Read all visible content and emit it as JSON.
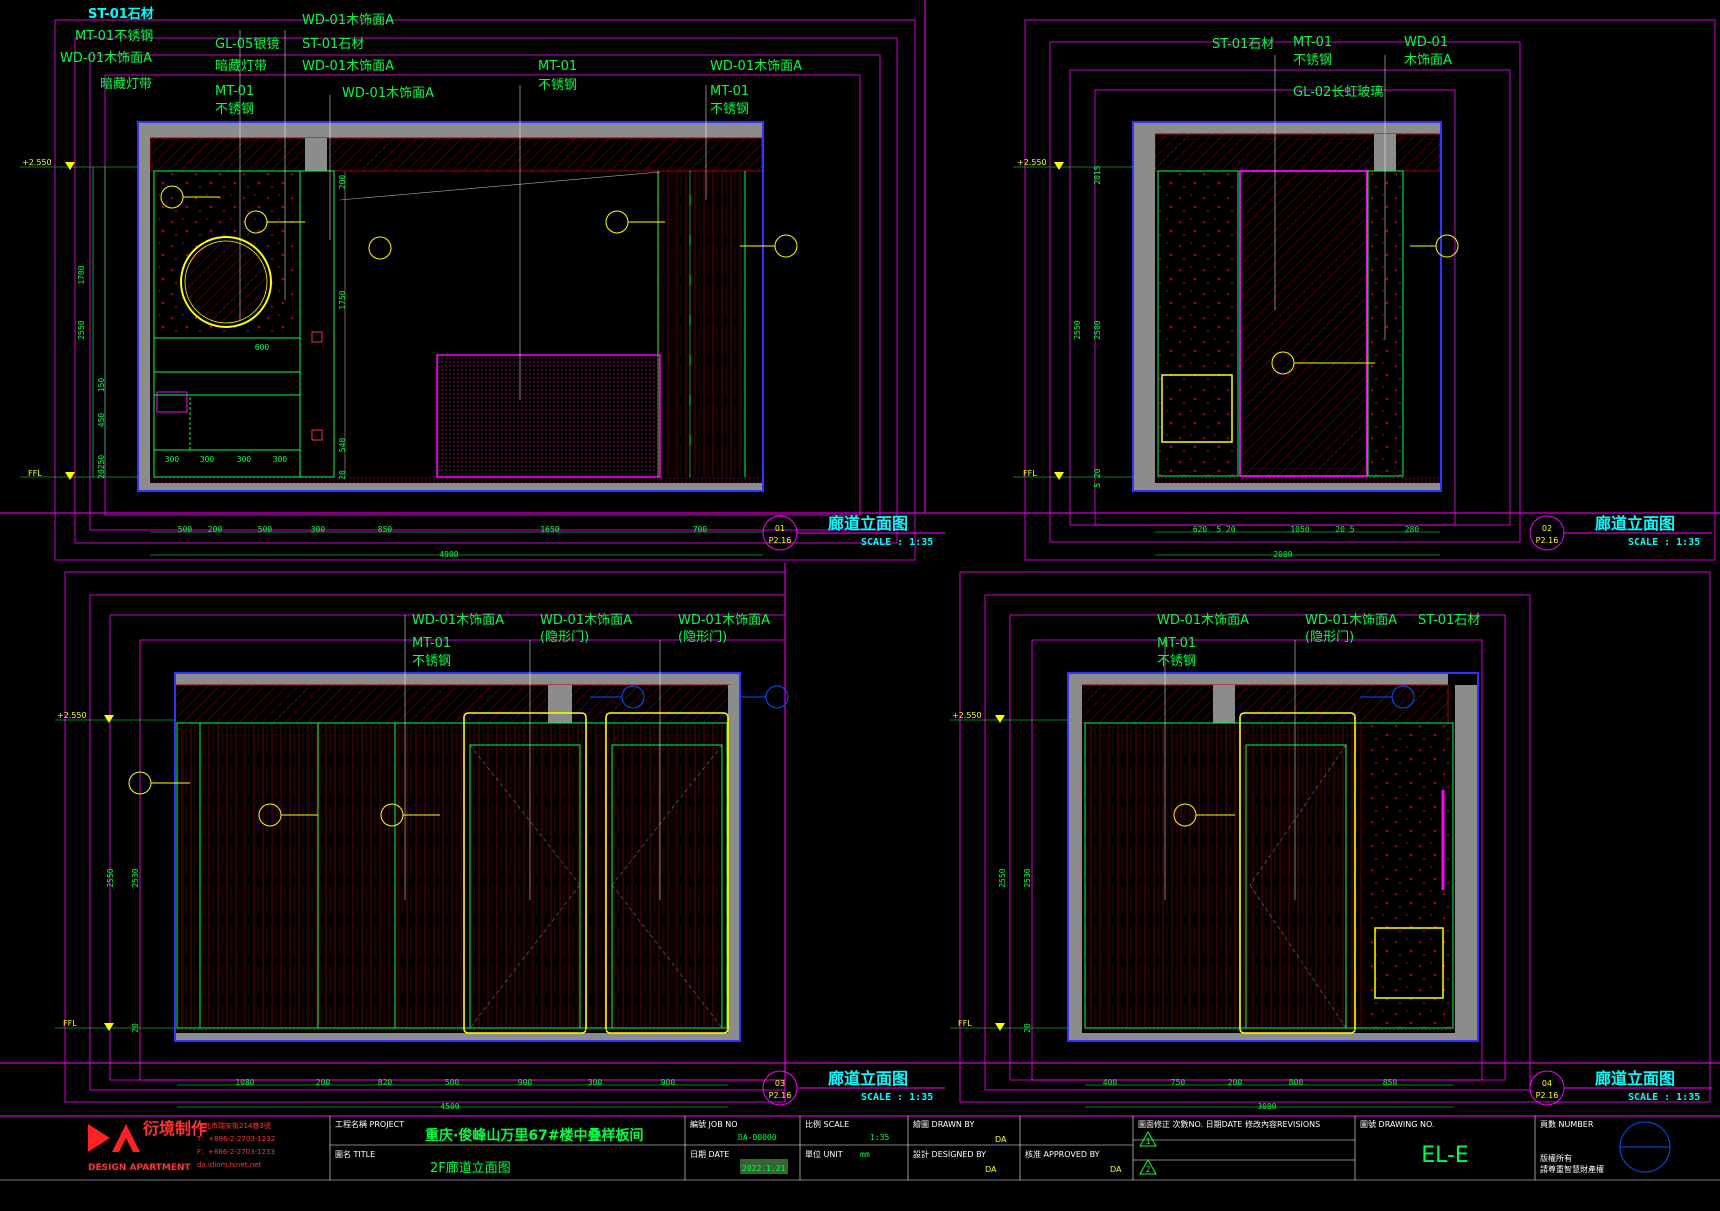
{
  "panels": [
    {
      "number": "01",
      "sheet": "P2.16",
      "title": "廊道立面图",
      "scale": "SCALE : 1:35",
      "labels": [
        "ST-01石材",
        "MT-01不锈钢",
        "WD-01木饰面A",
        "暗藏灯带",
        "GL-05银镜",
        "暗藏灯带",
        "MT-01",
        "不锈钢",
        "WD-01木饰面A",
        "ST-01石材",
        "WD-01木饰面A",
        "WD-01木饰面A",
        "MT-01",
        "不锈钢",
        "WD-01木饰面A",
        "MT-01",
        "不锈钢"
      ],
      "level_top": "+2.550",
      "level_bottom": "FFL",
      "dims_bottom": [
        "500",
        "200",
        "500",
        "300",
        "850",
        "1650",
        "700"
      ],
      "dim_total": "4900",
      "dims_left": [
        "1700",
        "2550",
        "150",
        "450",
        "250",
        "20"
      ],
      "dims_mid": [
        "600",
        "300",
        "300",
        "300",
        "300",
        "200",
        "1750",
        "540",
        "20"
      ]
    },
    {
      "number": "02",
      "sheet": "P2.16",
      "title": "廊道立面图",
      "scale": "SCALE : 1:35",
      "labels": [
        "ST-01石材",
        "MT-01",
        "不锈钢",
        "WD-01",
        "木饰面A",
        "GL-02长虹玻璃"
      ],
      "level_top": "+2.550",
      "level_bottom": "FFL",
      "dims_bottom": [
        "620",
        "5 20",
        "1050",
        "20 5",
        "280"
      ],
      "dim_total": "2000",
      "dims_left": [
        "2550",
        "2015",
        "2500",
        "5 20"
      ]
    },
    {
      "number": "03",
      "sheet": "P2.16",
      "title": "廊道立面图",
      "scale": "SCALE : 1:35",
      "labels": [
        "WD-01木饰面A",
        "MT-01",
        "不锈钢",
        "WD-01木饰面A",
        "(隐形门)",
        "WD-01木饰面A",
        "(隐形门)"
      ],
      "level_top": "+2.550",
      "level_bottom": "FFL",
      "dims_bottom": [
        "1080",
        "200",
        "820",
        "500",
        "900",
        "300",
        "900"
      ],
      "dim_total": "4500",
      "dims_left": [
        "2550",
        "2530",
        "20"
      ]
    },
    {
      "number": "04",
      "sheet": "P2.16",
      "title": "廊道立面图",
      "scale": "SCALE : 1:35",
      "labels": [
        "WD-01木饰面A",
        "MT-01",
        "不锈钢",
        "WD-01木饰面A",
        "(隐形门)",
        "ST-01石材"
      ],
      "level_top": "+2.550",
      "level_bottom": "FFL",
      "dims_bottom": [
        "400",
        "750",
        "200",
        "800",
        "850"
      ],
      "dim_total": "3000",
      "dims_left": [
        "2550",
        "2530",
        "20"
      ]
    }
  ],
  "title_block": {
    "brand_cn": "衍境制作",
    "brand_en": "DESIGN APARTMENT",
    "company_lines": [
      "台北市瑞安街214巷3號",
      "T：+886-2-2703-1232",
      "F：+886-2-2703-1233",
      "da.idiom.hinet.net"
    ],
    "project_label": "工程名稱 PROJECT",
    "project_name": "重庆·俊峰山万里67#楼中叠样板间",
    "title_label": "圖名 TITLE",
    "title_value": "2F廊道立面图",
    "job_label": "編號 JOB NO",
    "job_value": "DA-00000",
    "date_label": "日期 DATE",
    "date_value": "2022.1.21",
    "scale_label": "比例 SCALE",
    "scale_value": "1:35",
    "unit_label": "單位 UNIT",
    "unit_value": "mm",
    "drawn_label": "繪圖 DRAWN BY",
    "drawn_value": "DA",
    "designed_label": "設計 DESIGNED BY",
    "designed_value": "DA",
    "approved_label": "核准 APPROVED BY",
    "approved_value": "DA",
    "revision_label": "圖面修正 次數NO. 日期DATE 修改內容REVISIONS",
    "drawing_no_label": "圖號 DRAWING NO.",
    "drawing_no_value": "EL-E",
    "page_label": "頁數 NUMBER",
    "rights_lines": [
      "版權所有",
      "請尊重智慧財產權"
    ],
    "rev_marks": [
      "1",
      "2"
    ]
  },
  "colors": {
    "bg": "#000000",
    "cyan": "#00ffff",
    "green": "#00ff44",
    "magenta": "#ff00ff",
    "yellow": "#ffff00",
    "red": "#cc0000",
    "wall": "#8c8c8c",
    "blue": "#3333ff"
  }
}
